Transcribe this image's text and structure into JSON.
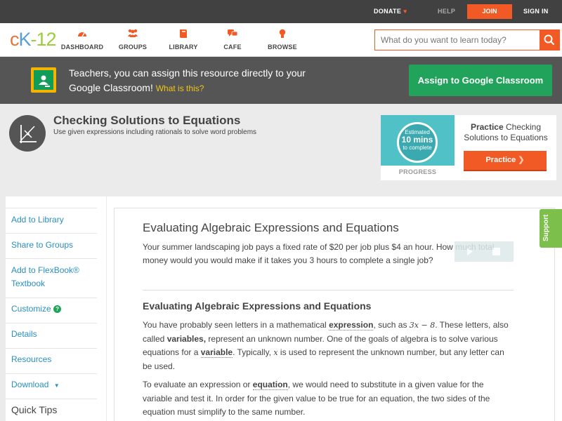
{
  "topbar": {
    "donate": "DONATE",
    "help": "HELP",
    "join": "JOIN",
    "signin": "SIGN IN"
  },
  "nav": {
    "logo": {
      "c": "c",
      "k": "K",
      "n": "-12"
    },
    "items": [
      {
        "label": "DASHBOARD",
        "icon": "dashboard-icon"
      },
      {
        "label": "GROUPS",
        "icon": "groups-icon"
      },
      {
        "label": "LIBRARY",
        "icon": "library-icon"
      },
      {
        "label": "CAFE",
        "icon": "cafe-icon"
      },
      {
        "label": "BROWSE",
        "icon": "browse-icon"
      }
    ],
    "search_placeholder": "What do you want to learn today?"
  },
  "teacher_bar": {
    "message": "Teachers, you can assign this resource directly to your Google Classroom!",
    "what_link": "What is this?",
    "assign_button": "Assign to Google Classroom"
  },
  "concept": {
    "title": "Checking Solutions to Equations",
    "subtitle": "Use given expressions including rationals to solve word problems"
  },
  "practice": {
    "estimate_line1": "Estimated",
    "estimate_num": "10 mins",
    "estimate_line3": "to complete",
    "progress_label": "PROGRESS",
    "text_bold": "Practice",
    "text_rest": "Checking Solutions to Equations",
    "button": "Practice"
  },
  "sidebar": {
    "items": [
      "Add to Library",
      "Share to Groups",
      "Add to FlexBook® Textbook",
      "Customize",
      "Details",
      "Resources",
      "Download"
    ],
    "quick_tips": "Quick Tips"
  },
  "main": {
    "heading": "Evaluating Algebraic Expressions and Equations",
    "intro": "Your summer landscaping job pays a fixed rate of $20 per job plus $4 an hour. How much total money would you would make if it takes you 3 hours to complete a single job?",
    "section_heading": "Evaluating Algebraic Expressions and Equations",
    "p1": {
      "a": "You have probably seen letters in a mathematical ",
      "term1": "expression",
      "b": ", such as ",
      "math1": "3x − 8",
      "c": ". These letters, also called ",
      "term2": "variables,",
      "d": " represent an unknown number. One of the goals of algebra is to solve various equations for a ",
      "term3": "variable",
      "e": ". Typically, ",
      "math2": "x",
      "f": " is used to represent the unknown number, but any letter can be used."
    },
    "p2": {
      "a": "To evaluate an expression or ",
      "term1": "equation",
      "b": ", we would need to substitute in a given value for the variable and test it. In order for the given value to be true for an equation, the two sides of the equation must simplify to the same number."
    }
  },
  "support": "Support",
  "colors": {
    "brand_orange": "#f15a24",
    "link_blue": "#2a8fc1",
    "classroom_green": "#21a35b",
    "support_green": "#7cc04b"
  }
}
